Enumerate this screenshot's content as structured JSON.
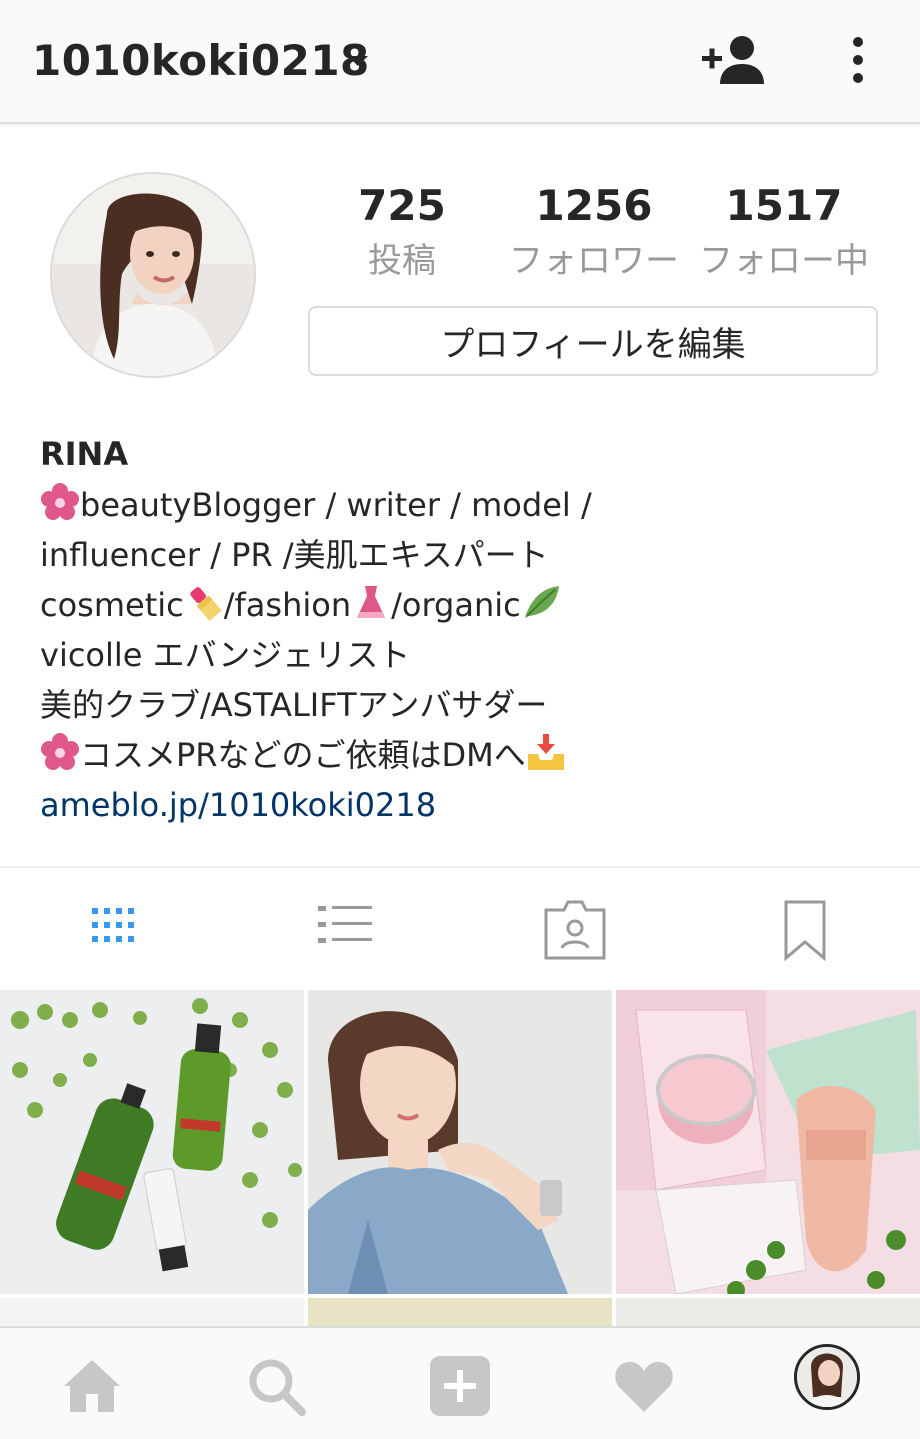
{
  "header": {
    "username": "1010koki0218",
    "dropdown_icon": "chevron-down-icon",
    "add_user_icon": "add-user-icon",
    "more_icon": "more-vertical-icon"
  },
  "profile": {
    "stats": [
      {
        "value": "725",
        "label": "投稿"
      },
      {
        "value": "1256",
        "label": "フォロワー"
      },
      {
        "value": "1517",
        "label": "フォロー中"
      }
    ],
    "edit_button": "プロフィールを編集",
    "name": "RINA",
    "bio_lines": [
      "beautyBlogger / writer / model /",
      " influencer / PR /美肌エキスパート",
      "cosmetic",
      "/fashion",
      "/organic",
      "vicolle エバンジェリスト",
      "美的クラブ/ASTALIFTアンバサダー",
      "コスメPRなどのご依頼はDMへ"
    ],
    "link": "ameblo.jp/1010koki0218"
  },
  "tabs": [
    {
      "name": "grid-view-icon",
      "active": true
    },
    {
      "name": "list-view-icon",
      "active": false
    },
    {
      "name": "tagged-icon",
      "active": false
    },
    {
      "name": "saved-bookmark-icon",
      "active": false
    }
  ],
  "colors": {
    "accent_blue": "#3897f0",
    "link": "#003569",
    "muted": "#999999",
    "icon_gray": "#c7c7c7"
  },
  "bottom_nav": [
    "home-icon",
    "search-icon",
    "add-post-icon",
    "activity-heart-icon",
    "profile-avatar"
  ]
}
